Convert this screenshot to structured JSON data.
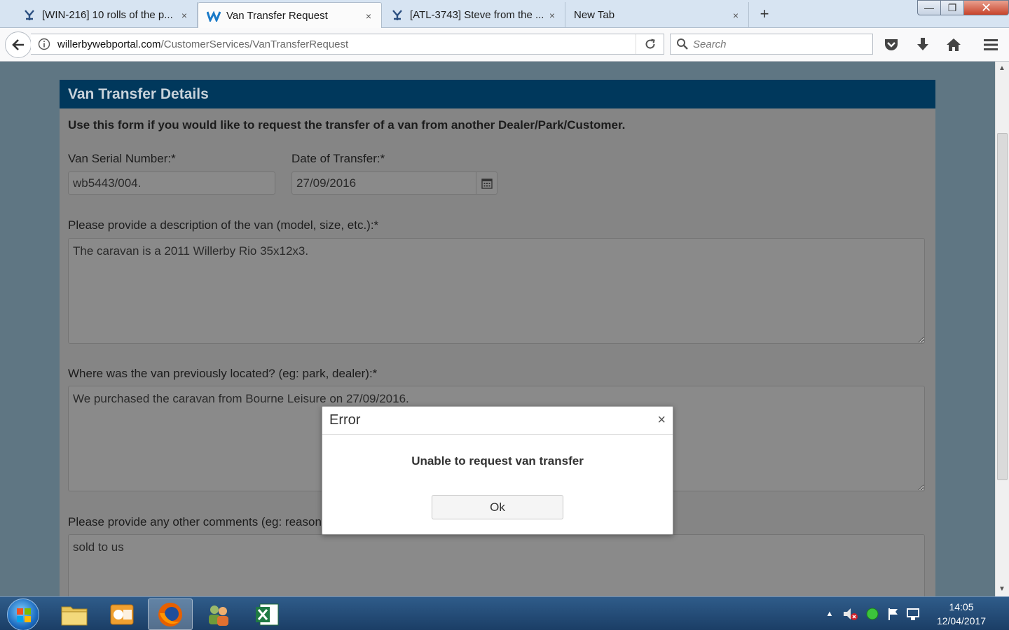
{
  "browser": {
    "tabs": [
      {
        "label": "[WIN-216] 10 rolls of the p...",
        "icon": "jira-icon"
      },
      {
        "label": "Van Transfer Request",
        "icon": "willerby-icon"
      },
      {
        "label": "[ATL-3743] Steve from the ...",
        "icon": "jira-icon"
      },
      {
        "label": "New Tab",
        "icon": ""
      }
    ],
    "tab_close": "×",
    "new_tab": "+",
    "window_min": "—",
    "window_max": "❐",
    "window_close": "✕",
    "url_domain": "willerbywebportal.com",
    "url_path": "/CustomerServices/VanTransferRequest",
    "search_placeholder": "Search"
  },
  "page": {
    "header": "Van Transfer Details",
    "intro": "Use this form if you would like to request the transfer of a van from another Dealer/Park/Customer.",
    "serial_label": "Van Serial Number:*",
    "serial_value": "wb5443/004.",
    "date_label": "Date of Transfer:*",
    "date_value": "27/09/2016",
    "description_label": "Please provide a description of the van (model, size, etc.):*",
    "description_value": "The caravan is a 2011 Willerby Rio 35x12x3.",
    "location_label": "Where was the van previously located? (eg: park, dealer):*",
    "location_value": "We purchased the caravan from Bourne Leisure on 27/09/2016.",
    "comments_label": "Please provide any other comments (eg: reason",
    "comments_value": "sold to us"
  },
  "modal": {
    "title": "Error",
    "close": "×",
    "message": "Unable to request van transfer",
    "ok_label": "Ok"
  },
  "taskbar": {
    "time": "14:05",
    "date": "12/04/2017"
  },
  "colors": {
    "header_bg": "#00385c",
    "overlay_bg": "#5f7683",
    "tab_strip": "#d7e4f2"
  }
}
